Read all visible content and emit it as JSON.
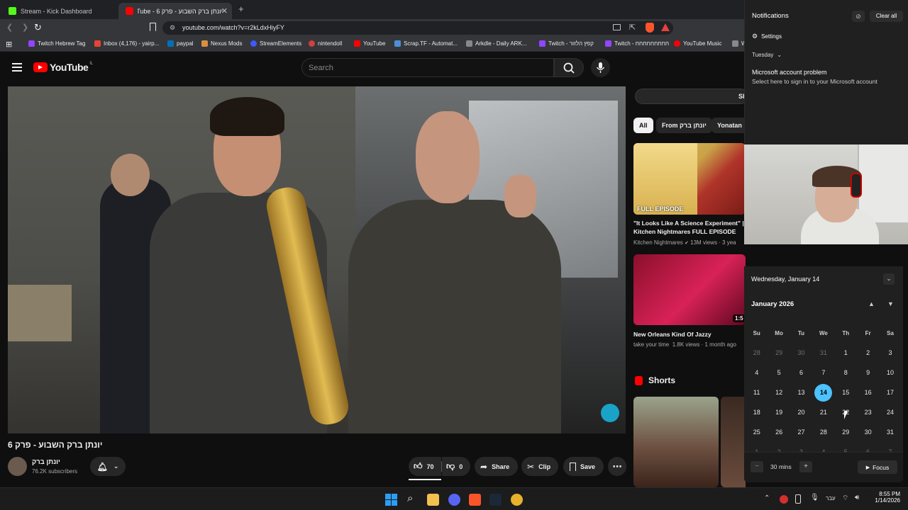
{
  "browser": {
    "tabs": [
      {
        "label": "Stream - Kick Dashboard",
        "active": false
      },
      {
        "label": "יונתן ברק השבוע - פרק 6 - YouTube",
        "active": true
      }
    ],
    "new_tab": "+",
    "url": "youtube.com/watch?v=r2kLdxHiyFY",
    "bookmarks": [
      "Twitch Hebrew Tag",
      "Inbox (4,176) - yairp...",
      "paypal",
      "Nexus Mods",
      "StreamElements",
      "nintendoll",
      "YouTube",
      "Scrap.TF - Automat...",
      "Arkdle - Daily ARK...",
      "Twitch - קפץ הלזור",
      "Twitch - חחחחחחחחח",
      "YouTube Music",
      "W"
    ]
  },
  "youtube": {
    "logo": "YouTube",
    "country": "IL",
    "search_placeholder": "Search",
    "video_title": "יונתן ברק השבוע - פרק 6",
    "channel_name": "יונתן ברק",
    "subscribers": "76.2K subscribers",
    "likes": "70",
    "dislikes": "0",
    "share": "Share",
    "clip": "Clip",
    "save": "Save",
    "chips": [
      "All",
      "From יונתן ברק",
      "Yonatan"
    ],
    "side_partial": "Sl",
    "recommended": [
      {
        "title": "\"It Looks Like A Science Experiment\" | Kitchen Nightmares FULL EPISODE",
        "channel": "Kitchen Nightmares",
        "meta": "13M views · 3 yea",
        "thumb_label": "FULL EPISODE"
      },
      {
        "title": "New Orleans Kind Of Jazzy",
        "channel": "take your time",
        "meta": "1.8K views · 1 month ago",
        "duration": "1:5"
      }
    ],
    "shorts_label": "Shorts"
  },
  "notifications": {
    "title": "Notifications",
    "clear_all": "Clear all",
    "settings": "Settings",
    "group": "Tuesday",
    "item_title": "Microsoft account problem",
    "item_body": "Select here to sign in to your Microsoft account"
  },
  "calendar": {
    "header": "Wednesday, January 14",
    "month": "January 2026",
    "weekdays": [
      "Su",
      "Mo",
      "Tu",
      "We",
      "Th",
      "Fr",
      "Sa"
    ],
    "weeks": [
      [
        "28",
        "29",
        "30",
        "31",
        "1",
        "2",
        "3"
      ],
      [
        "4",
        "5",
        "6",
        "7",
        "8",
        "9",
        "10"
      ],
      [
        "11",
        "12",
        "13",
        "14",
        "15",
        "16",
        "17"
      ],
      [
        "18",
        "19",
        "20",
        "21",
        "22",
        "23",
        "24"
      ],
      [
        "25",
        "26",
        "27",
        "28",
        "29",
        "30",
        "31"
      ],
      [
        "1",
        "2",
        "3",
        "4",
        "5",
        "6",
        "7"
      ]
    ],
    "today": "14",
    "focus_minutes": "30 mins",
    "focus_label": "Focus",
    "minus": "−",
    "plus": "+"
  },
  "taskbar": {
    "lang": "עבר",
    "time": "8:55 PM",
    "date": "1/14/2026"
  },
  "colors": {
    "accent": "#4cc2ff",
    "yt_red": "#ff0000",
    "bg": "#0f0f0f"
  }
}
